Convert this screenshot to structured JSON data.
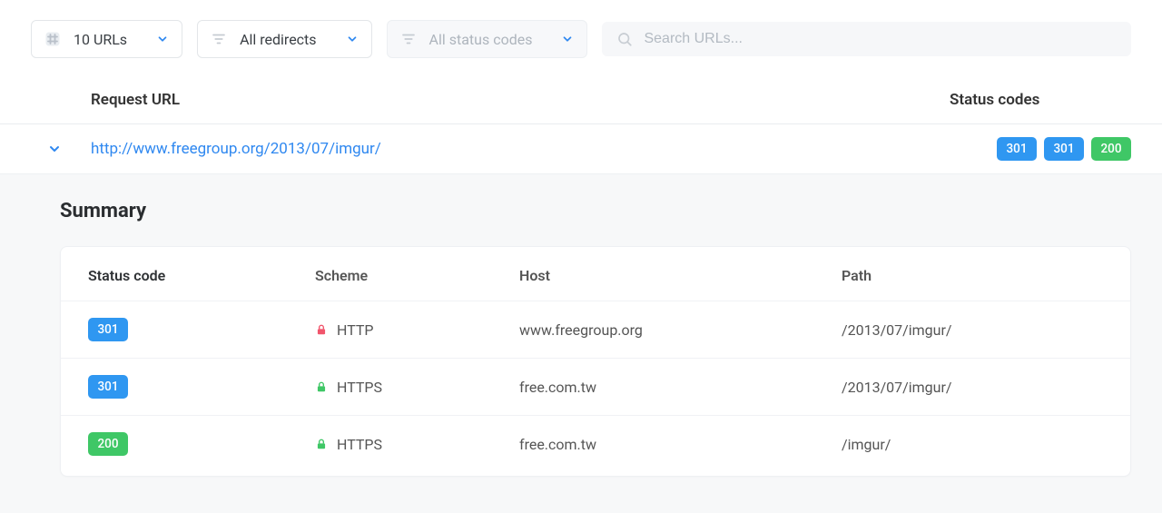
{
  "toolbar": {
    "urls_filter": "10 URLs",
    "redirects_filter": "All redirects",
    "status_filter": "All status codes",
    "search_placeholder": "Search URLs..."
  },
  "table": {
    "headers": {
      "url": "Request URL",
      "status": "Status codes"
    },
    "row": {
      "url": "http://www.freegroup.org/2013/07/imgur/",
      "badges": [
        {
          "code": "301",
          "color": "blue"
        },
        {
          "code": "301",
          "color": "blue"
        },
        {
          "code": "200",
          "color": "green"
        }
      ]
    }
  },
  "summary": {
    "title": "Summary",
    "headers": {
      "status": "Status code",
      "scheme": "Scheme",
      "host": "Host",
      "path": "Path"
    },
    "rows": [
      {
        "status": "301",
        "status_color": "blue",
        "scheme": "HTTP",
        "lock": "red",
        "host": "www.freegroup.org",
        "path": "/2013/07/imgur/"
      },
      {
        "status": "301",
        "status_color": "blue",
        "scheme": "HTTPS",
        "lock": "green",
        "host": "free.com.tw",
        "path": "/2013/07/imgur/"
      },
      {
        "status": "200",
        "status_color": "green",
        "scheme": "HTTPS",
        "lock": "green",
        "host": "free.com.tw",
        "path": "/imgur/"
      }
    ]
  }
}
